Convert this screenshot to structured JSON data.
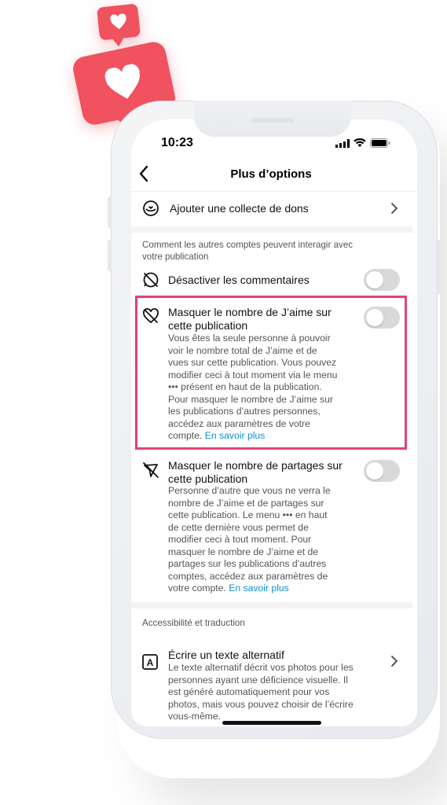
{
  "status_bar": {
    "time": "10:23"
  },
  "header": {
    "title": "Plus d’options"
  },
  "fundraiser": {
    "label": "Ajouter une collecte de dons"
  },
  "interactions_section": {
    "title_line1": "Comment les autres comptes peuvent interagir avec",
    "title_line2": "votre publication"
  },
  "disable_comments": {
    "label": "Désactiver les commentaires",
    "enabled": false
  },
  "hide_likes": {
    "label_line1": "Masquer le nombre de J’aime sur",
    "label_line2": "cette publication",
    "desc_lines": [
      "Vous êtes la seule personne à pouvoir",
      "voir le nombre total de J’aime et de",
      "vues sur cette publication. Vous pouvez",
      "modifier ceci à tout moment via le menu",
      "••• présent en haut de la publication.",
      "Pour masquer le nombre de J’aime sur",
      "les publications d’autres personnes,",
      "accédez aux paramètres de votre"
    ],
    "desc_last": "compte.",
    "link": "En savoir plus",
    "enabled": false
  },
  "hide_shares": {
    "label_line1": "Masquer le nombre de partages sur",
    "label_line2": "cette publication",
    "desc_lines": [
      "Personne d’autre que vous ne verra le",
      "nombre de J’aime et de partages sur",
      "cette publication. Le menu ••• en haut",
      "de cette dernière vous permet de",
      "modifier ceci à tout moment. Pour",
      "masquer le nombre de J’aime et de",
      "partages sur les publications d’autres",
      "comptes, accédez aux paramètres de"
    ],
    "desc_last": "votre compte.",
    "link": "En savoir plus",
    "enabled": false
  },
  "accessibility_section": {
    "title": "Accessibilité et traduction"
  },
  "alt_text": {
    "label": "Écrire un texte alternatif",
    "desc_lines": [
      "Le texte alternatif décrit vos photos pour les",
      "personnes ayant une déficience visuelle. Il",
      "est généré automatiquement pour vos",
      "photos, mais vous pouvez choisir de l’écrire",
      "vous-même."
    ]
  },
  "colors": {
    "accent_link": "#0b8fd6",
    "highlight": "#e4407b",
    "bubble": "#f0525f",
    "toggle_off": "#d9d9d9"
  },
  "icons": [
    "heart-icon",
    "back-chevron-icon",
    "donation-icon",
    "comments-off-icon",
    "likes-hidden-icon",
    "shares-hidden-icon",
    "alt-text-icon",
    "chevron-right-icon",
    "signal-icon",
    "wifi-icon",
    "battery-icon"
  ]
}
